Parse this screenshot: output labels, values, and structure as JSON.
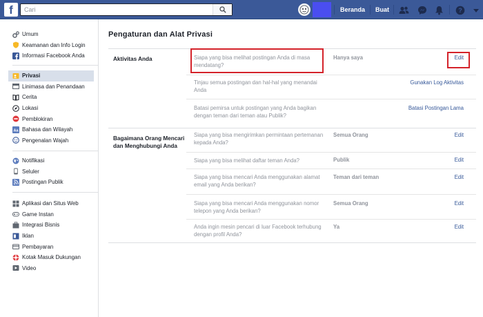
{
  "topbar": {
    "logo": "f",
    "search_placeholder": "Cari",
    "nav_home": "Beranda",
    "nav_create": "Buat",
    "icons": [
      "friend-requests-icon",
      "messenger-icon",
      "notifications-icon",
      "help-icon",
      "account-menu-icon"
    ]
  },
  "colors": {
    "brand": "#3b5998",
    "link": "#365899",
    "highlight": "#d4222a"
  },
  "sidebar": {
    "group1": [
      {
        "label": "Umum",
        "icon": "gear-icon"
      },
      {
        "label": "Keamanan dan Info Login",
        "icon": "shield-icon"
      },
      {
        "label": "Informasi Facebook Anda",
        "icon": "facebook-icon"
      }
    ],
    "group2": [
      {
        "label": "Privasi",
        "icon": "lock-icon"
      },
      {
        "label": "Linimasa dan Penandaan",
        "icon": "timeline-icon"
      },
      {
        "label": "Cerita",
        "icon": "book-icon"
      },
      {
        "label": "Lokasi",
        "icon": "location-icon"
      },
      {
        "label": "Pemblokiran",
        "icon": "block-icon"
      },
      {
        "label": "Bahasa dan Wilayah",
        "icon": "language-icon"
      },
      {
        "label": "Pengenalan Wajah",
        "icon": "face-icon"
      }
    ],
    "group3": [
      {
        "label": "Notifikasi",
        "icon": "globe-icon"
      },
      {
        "label": "Seluler",
        "icon": "mobile-icon"
      },
      {
        "label": "Postingan Publik",
        "icon": "rss-icon"
      }
    ],
    "group4": [
      {
        "label": "Aplikasi dan Situs Web",
        "icon": "apps-icon"
      },
      {
        "label": "Game Instan",
        "icon": "game-icon"
      },
      {
        "label": "Integrasi Bisnis",
        "icon": "business-icon"
      },
      {
        "label": "Iklan",
        "icon": "ads-icon"
      },
      {
        "label": "Pembayaran",
        "icon": "payment-icon"
      },
      {
        "label": "Kotak Masuk Dukungan",
        "icon": "support-icon"
      },
      {
        "label": "Video",
        "icon": "video-icon"
      }
    ]
  },
  "main": {
    "title": "Pengaturan dan Alat Privasi",
    "sections": [
      {
        "heading": "Aktivitas Anda",
        "rows": [
          {
            "question": "Siapa yang bisa melihat postingan Anda di masa mendatang?",
            "value": "Hanya saya",
            "action": "Edit"
          },
          {
            "question": "Tinjau semua postingan dan hal-hal yang menandai Anda",
            "value": "",
            "action": "Gunakan Log Aktivitas"
          },
          {
            "question": "Batasi pemirsa untuk postingan yang Anda bagikan dengan teman dari teman atau Publik?",
            "value": "",
            "action": "Batasi Postingan Lama"
          }
        ]
      },
      {
        "heading": "Bagaimana Orang Mencari dan Menghubungi Anda",
        "rows": [
          {
            "question": "Siapa yang bisa mengirimkan permintaan pertemanan kepada Anda?",
            "value": "Semua Orang",
            "action": "Edit"
          },
          {
            "question": "Siapa yang bisa melihat daftar teman Anda?",
            "value": "Publik",
            "action": "Edit"
          },
          {
            "question": "Siapa yang bisa mencari Anda menggunakan alamat email yang Anda berikan?",
            "value": "Teman dari teman",
            "action": "Edit"
          },
          {
            "question": "Siapa yang bisa mencari Anda menggunakan nomor telepon yang Anda berikan?",
            "value": "Semua Orang",
            "action": "Edit"
          },
          {
            "question": "Anda ingin mesin pencari di luar Facebook terhubung dengan profil Anda?",
            "value": "Ya",
            "action": "Edit"
          }
        ]
      }
    ]
  }
}
